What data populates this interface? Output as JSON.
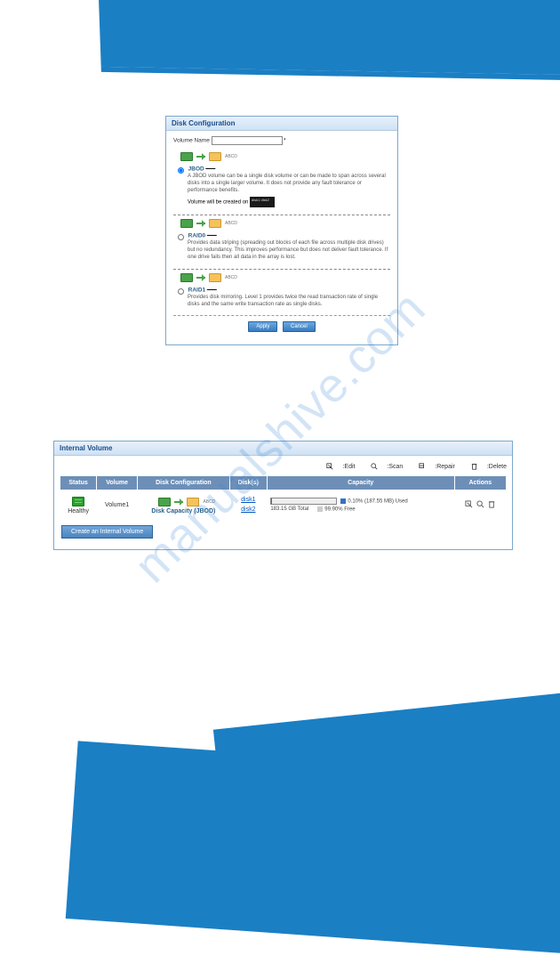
{
  "watermark": "manualshive.com",
  "disk_config": {
    "title": "Disk Configuration",
    "volume_name_label": "Volume Name",
    "volume_name_value": "",
    "volume_name_hint": "*",
    "jbod": {
      "title": "JBOD",
      "abcd": "ABCD",
      "desc": "A JBOD volume can be a single disk volume or can be made to span across several disks into a single larger volume. It does not provide any fault tolerance or performance benefits.",
      "created_on_label": "Volume will be created on",
      "created_on_box": "disk1\ndisk2"
    },
    "raid0": {
      "title": "RAID0",
      "abcd": "ABCD",
      "desc": "Provides data striping (spreading out blocks of each file across multiple disk drives) but no redundancy. This improves performance but does not deliver fault tolerance. If one drive fails then all data in the array is lost."
    },
    "raid1": {
      "title": "RAID1",
      "abcd": "ABCD",
      "desc": "Provides disk mirroring. Level 1 provides twice the read transaction rate of single disks and the same write transaction rate as single disks."
    },
    "apply": "Apply",
    "cancel": "Cancel"
  },
  "internal_volume": {
    "title": "Internal Volume",
    "legend": {
      "edit": ":Edit",
      "scan": ":Scan",
      "repair": ":Repair",
      "delete": ":Delete"
    },
    "columns": {
      "status": "Status",
      "volume": "Volume",
      "disk_config": "Disk Configuration",
      "disks": "Disk(s)",
      "capacity": "Capacity",
      "actions": "Actions"
    },
    "row": {
      "status": "Healthy",
      "volume": "Volume1",
      "dc_label": "Disk Capacity (JBOD)",
      "dc_abcd": "ABCD",
      "disk1": "disk1",
      "disk2": "disk2",
      "used_pct": "0.10% (187.55 MB) Used",
      "total": "183.15 GB Total",
      "free_pct": "99.90% Free"
    },
    "create_btn": "Create an Internal Volume"
  }
}
